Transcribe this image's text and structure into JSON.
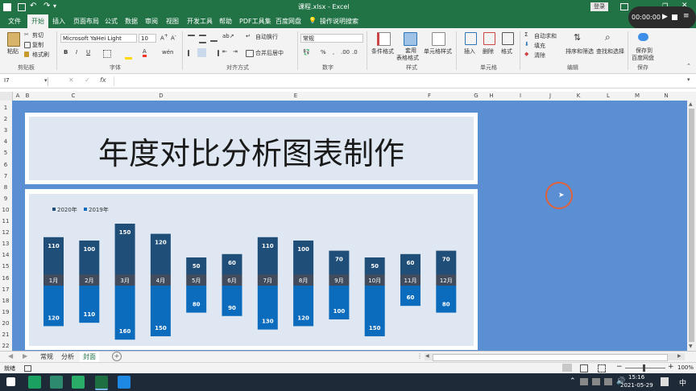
{
  "titlebar": {
    "filename": "课程.xlsx - Excel",
    "login_label": "登录",
    "timer": "00:00:00"
  },
  "tabs": [
    "文件",
    "开始",
    "插入",
    "页面布局",
    "公式",
    "数据",
    "审阅",
    "视图",
    "开发工具",
    "帮助",
    "PDF工具集",
    "百度网盘"
  ],
  "active_tab": "开始",
  "tell_me": "操作说明搜索",
  "ribbon": {
    "paste": "粘贴",
    "cut": "剪切",
    "copy": "复制",
    "format_painter": "格式刷",
    "clipboard_group": "剪贴板",
    "font_name": "Microsoft YaHei Light",
    "font_size": "10",
    "font_group": "字体",
    "wrap_text": "自动换行",
    "merge_center": "合并后居中",
    "alignment_group": "对齐方式",
    "number_format": "常规",
    "number_group": "数字",
    "conditional_format": "条件格式",
    "table_format": "套用\n表格格式",
    "table_format_1": "套用",
    "table_format_2": "表格格式",
    "cell_styles": "单元格样式",
    "styles_group": "样式",
    "insert": "插入",
    "delete": "删除",
    "format": "格式",
    "cells_group": "单元格",
    "autosum": "自动求和",
    "fill": "填充",
    "clear": "清除",
    "sort_filter": "排序和筛选",
    "find_select": "查找和选择",
    "editing_group": "编辑",
    "save_baidu_1": "保存到",
    "save_baidu_2": "百度网盘",
    "save_group": "保存"
  },
  "formula_bar": {
    "name_box": "I7",
    "fx": "fx",
    "content": ""
  },
  "columns": [
    "A",
    "B",
    "C",
    "D",
    "E",
    "F",
    "G",
    "H",
    "I",
    "J",
    "K",
    "L",
    "M",
    "N"
  ],
  "rows": [
    "1",
    "2",
    "3",
    "4",
    "5",
    "6",
    "7",
    "8",
    "9",
    "10",
    "11",
    "12",
    "13",
    "14",
    "15",
    "16",
    "17",
    "18",
    "19",
    "20",
    "21",
    "22"
  ],
  "sheet_title": "年度对比分析图表制作",
  "sheet_tabs": [
    "常规",
    "分析",
    "封面"
  ],
  "active_sheet": "封面",
  "status": {
    "ready": "就绪",
    "zoom": "100%"
  },
  "taskbar": {
    "time": "15:16",
    "date": "2021-05-29",
    "lang": "中"
  },
  "colors": {
    "excel_green": "#217346",
    "sheet_bg": "#5b8fd4",
    "panel_bg": "#dfe8f2",
    "series_2020": "#1f4e79",
    "series_2019": "#0b6bbd",
    "month_band": "#404c5e"
  },
  "chart_data": {
    "type": "bar",
    "legend": [
      "2020年",
      "2019年"
    ],
    "categories": [
      "1月",
      "2月",
      "3月",
      "4月",
      "5月",
      "6月",
      "7月",
      "8月",
      "9月",
      "10月",
      "11月",
      "12月"
    ],
    "series": [
      {
        "name": "2020年",
        "values": [
          110,
          100,
          150,
          120,
          50,
          60,
          110,
          100,
          70,
          50,
          60,
          70
        ]
      },
      {
        "name": "2019年",
        "values": [
          120,
          110,
          160,
          150,
          80,
          90,
          130,
          120,
          100,
          150,
          60,
          80
        ]
      }
    ]
  }
}
